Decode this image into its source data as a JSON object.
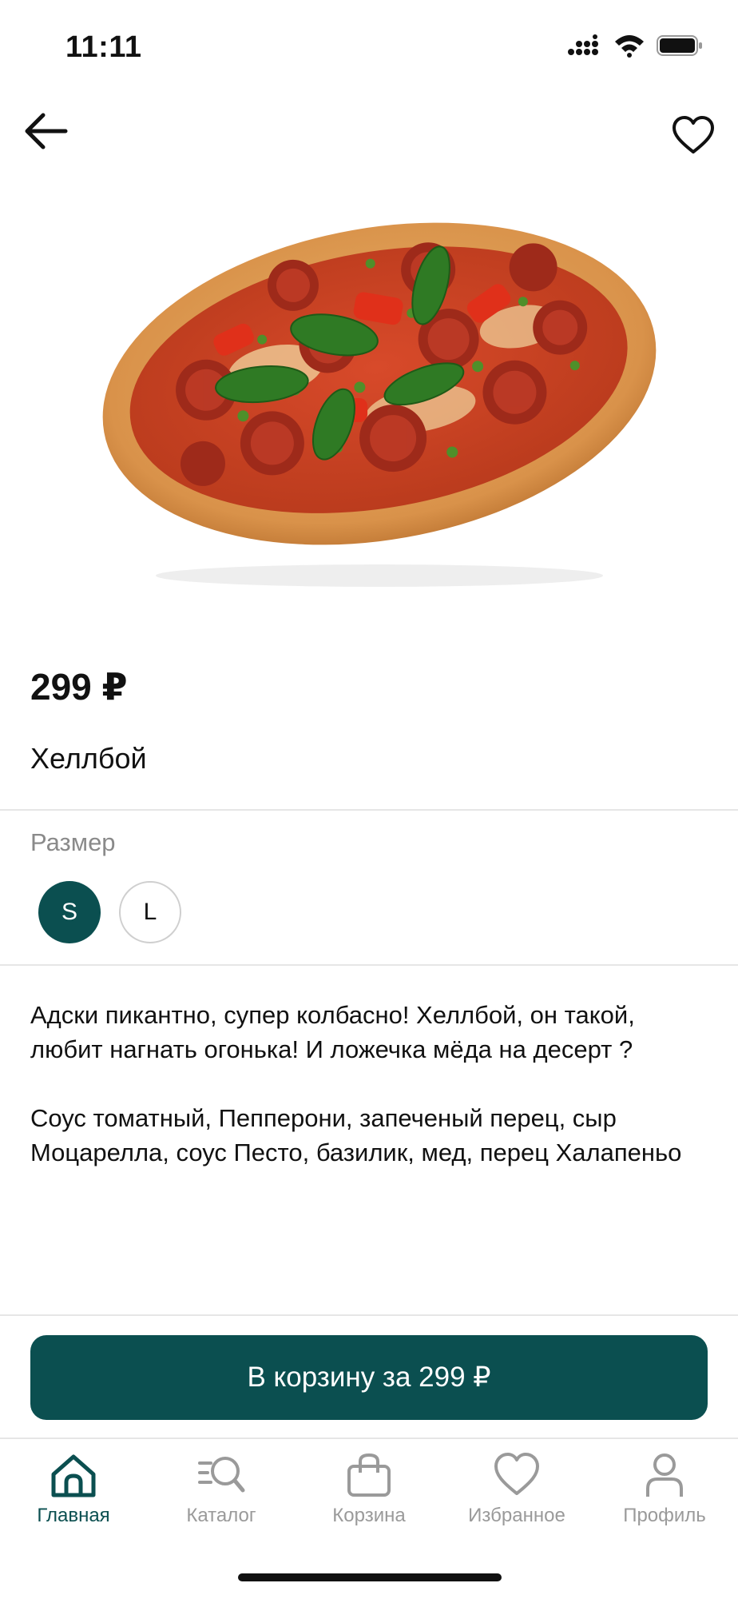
{
  "status_bar": {
    "time": "11:11"
  },
  "product": {
    "price": "299 ₽",
    "title": "Хеллбой",
    "size_label": "Размер",
    "sizes": [
      "S",
      "L"
    ],
    "selected_size": "S",
    "description": [
      "Адски пикантно, супер колбасно! Хеллбой, он такой, любит нагнать огонька! И ложечка мёда на десерт ?",
      "Соус томатный, Пепперони, запеченый перец, сыр Моцарелла, соус Песто, базилик, мед, перец Халапеньо"
    ]
  },
  "cart_button": {
    "label": "В корзину за 299 ₽"
  },
  "tab_bar": {
    "tabs": [
      {
        "label": "Главная",
        "icon": "home-icon",
        "active": true
      },
      {
        "label": "Каталог",
        "icon": "catalog-search-icon",
        "active": false
      },
      {
        "label": "Корзина",
        "icon": "bag-icon",
        "active": false
      },
      {
        "label": "Избранное",
        "icon": "heart-icon",
        "active": false
      },
      {
        "label": "Профиль",
        "icon": "profile-icon",
        "active": false
      }
    ]
  },
  "colors": {
    "accent": "#0b4f50",
    "inactive": "#9a9a9a",
    "divider": "#e6e6e6"
  }
}
